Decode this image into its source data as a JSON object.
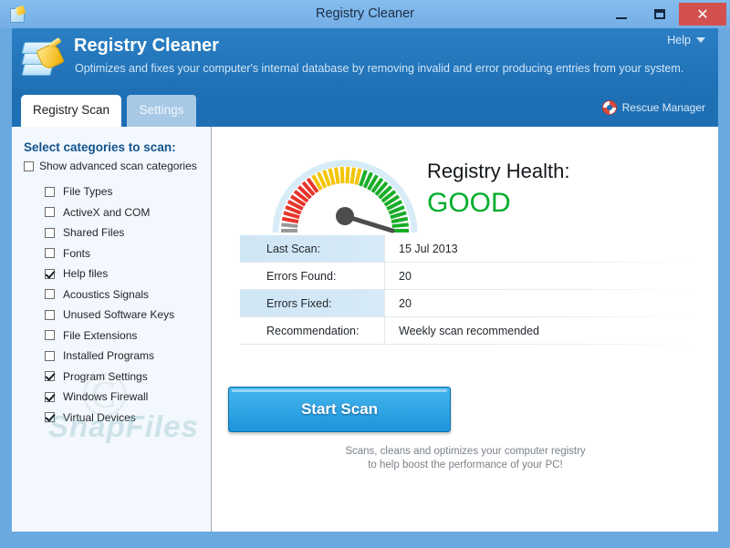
{
  "titlebar": {
    "title": "Registry Cleaner",
    "app_icon": "registry-cleaner-icon",
    "minimize": "−",
    "maximize": "□",
    "close": "✕"
  },
  "header": {
    "logo_icon": "registry-brush-logo-icon",
    "title": "Registry Cleaner",
    "subtitle": "Optimizes and fixes your computer's internal database by removing invalid and error producing entries from your system.",
    "help_label": "Help",
    "help_caret_icon": "chevron-down-icon"
  },
  "tabs": {
    "items": [
      {
        "label": "Registry Scan",
        "active": true
      },
      {
        "label": "Settings",
        "active": false
      }
    ],
    "rescue_label": "Rescue Manager",
    "rescue_icon": "lifebuoy-icon"
  },
  "sidebar": {
    "title": "Select categories to scan:",
    "advanced": {
      "label": "Show advanced scan categories",
      "checked": false
    },
    "categories": [
      {
        "label": "File Types",
        "checked": false
      },
      {
        "label": "ActiveX and COM",
        "checked": false
      },
      {
        "label": "Shared Files",
        "checked": false
      },
      {
        "label": "Fonts",
        "checked": false
      },
      {
        "label": "Help files",
        "checked": true
      },
      {
        "label": "Acoustics Signals",
        "checked": false
      },
      {
        "label": "Unused Software Keys",
        "checked": false
      },
      {
        "label": "File Extensions",
        "checked": false
      },
      {
        "label": "Installed Programs",
        "checked": false
      },
      {
        "label": "Program Settings",
        "checked": true
      },
      {
        "label": "Windows Firewall",
        "checked": true
      },
      {
        "label": "Virtual Devices",
        "checked": true
      }
    ]
  },
  "main": {
    "gauge": {
      "icon": "health-gauge-icon",
      "needle_zone": "green",
      "segment_colors": [
        "#9a9a9a",
        "#e8342a",
        "#f5c400",
        "#19ad28"
      ]
    },
    "health_label": "Registry Health:",
    "health_value": "GOOD",
    "health_color": "#00ad2a",
    "table": [
      {
        "label": "Last Scan:",
        "value": "15 Jul 2013"
      },
      {
        "label": "Errors Found:",
        "value": "20"
      },
      {
        "label": "Errors Fixed:",
        "value": "20"
      },
      {
        "label": "Recommendation:",
        "value": "Weekly scan recommended"
      }
    ],
    "scan_button": "Start Scan",
    "hint_line1": "Scans, cleans and optimizes your computer registry",
    "hint_line2": "to help boost the performance of your PC!"
  },
  "watermark": {
    "copyright": "©",
    "text": "SnapFiles"
  }
}
